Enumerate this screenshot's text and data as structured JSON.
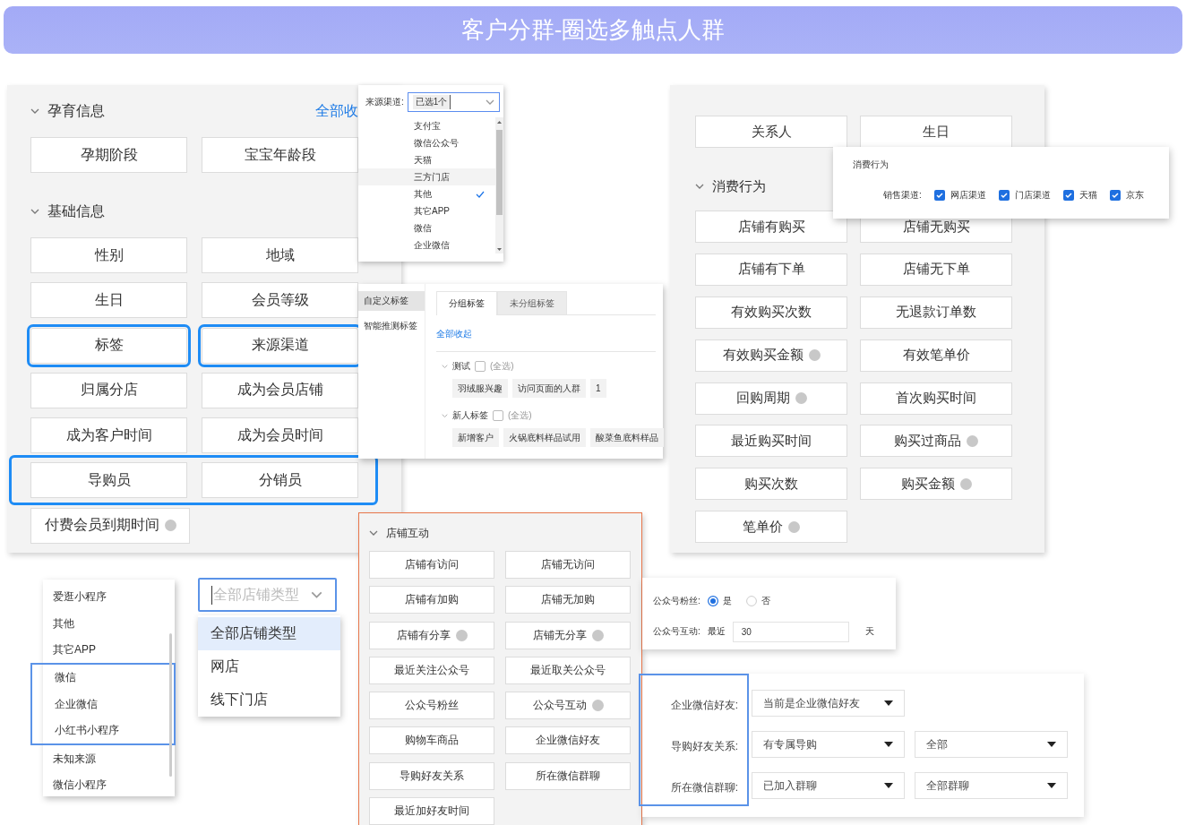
{
  "header": {
    "title": "客户分群-圈选多触点人群"
  },
  "panels": [
    {
      "kind": "buttons",
      "sections": [
        {
          "title": "孕育信息",
          "link": "全部收",
          "rows": [
            {
              "highlighted": false,
              "items": [
                {
                  "label": "孕期阶段",
                  "info": false,
                  "highlighted": false
                },
                {
                  "label": "宝宝年龄段",
                  "info": false,
                  "highlighted": false
                }
              ]
            }
          ]
        },
        {
          "title": "基础信息",
          "rows": [
            {
              "highlighted": false,
              "items": [
                {
                  "label": "性别",
                  "info": false,
                  "highlighted": false
                },
                {
                  "label": "地域",
                  "info": false,
                  "highlighted": false
                }
              ]
            },
            {
              "highlighted": false,
              "items": [
                {
                  "label": "生日",
                  "info": false,
                  "highlighted": false
                },
                {
                  "label": "会员等级",
                  "info": false,
                  "highlighted": false
                }
              ]
            },
            {
              "highlighted": false,
              "items": [
                {
                  "label": "标签",
                  "info": false,
                  "highlighted": true
                },
                {
                  "label": "来源渠道",
                  "info": false,
                  "highlighted": true
                }
              ]
            },
            {
              "highlighted": false,
              "items": [
                {
                  "label": "归属分店",
                  "info": false,
                  "highlighted": false
                },
                {
                  "label": "成为会员店铺",
                  "info": false,
                  "highlighted": false
                }
              ]
            },
            {
              "highlighted": false,
              "items": [
                {
                  "label": "成为客户时间",
                  "info": false,
                  "highlighted": false
                },
                {
                  "label": "成为会员时间",
                  "info": false,
                  "highlighted": false
                }
              ]
            },
            {
              "highlighted": true,
              "items": [
                {
                  "label": "导购员",
                  "info": false,
                  "highlighted": false
                },
                {
                  "label": "分销员",
                  "info": false,
                  "highlighted": false
                }
              ]
            },
            {
              "highlighted": false,
              "items": [
                {
                  "label": "付费会员到期时间",
                  "info": true,
                  "highlighted": false
                }
              ]
            }
          ]
        }
      ]
    },
    {
      "kind": "multi_dropdown",
      "label": "来源渠道:",
      "value": "已选1个",
      "options": [
        {
          "label": "支付宝",
          "selected": false,
          "hovered": false
        },
        {
          "label": "微信公众号",
          "selected": false,
          "hovered": false
        },
        {
          "label": "天猫",
          "selected": false,
          "hovered": false
        },
        {
          "label": "三方门店",
          "selected": false,
          "hovered": true
        },
        {
          "label": "其他",
          "selected": true,
          "hovered": false
        },
        {
          "label": "其它APP",
          "selected": false,
          "hovered": false
        },
        {
          "label": "微信",
          "selected": false,
          "hovered": false
        },
        {
          "label": "企业微信",
          "selected": false,
          "hovered": false
        }
      ]
    },
    {
      "kind": "tag_picker",
      "sidebar": [
        {
          "label": "自定义标签",
          "selected": true
        },
        {
          "label": "智能推测标签",
          "selected": false
        }
      ],
      "tabs": [
        {
          "label": "分组标签",
          "selected": true
        },
        {
          "label": "未分组标签",
          "selected": false
        }
      ],
      "link": "全部收起",
      "groups": [
        {
          "name": "测试",
          "checked": false,
          "select_all": "(全选)",
          "tags": [
            "羽绒服兴趣",
            "访问页面的人群",
            "1"
          ]
        },
        {
          "name": "新人标签",
          "checked": false,
          "select_all": "(全选)",
          "tags": [
            "新增客户",
            "火锅底料样品试用",
            "酸菜鱼底料样品"
          ]
        }
      ]
    },
    {
      "kind": "buttons",
      "sections": [
        {
          "rows": [
            {
              "highlighted": false,
              "items": [
                {
                  "label": "关系人",
                  "info": false,
                  "highlighted": false
                },
                {
                  "label": "生日",
                  "info": false,
                  "highlighted": false
                }
              ]
            }
          ]
        },
        {
          "title": "消费行为",
          "rows": [
            {
              "highlighted": false,
              "items": [
                {
                  "label": "店铺有购买",
                  "info": false,
                  "highlighted": false
                },
                {
                  "label": "店铺无购买",
                  "info": false,
                  "highlighted": false
                }
              ]
            },
            {
              "highlighted": false,
              "items": [
                {
                  "label": "店铺有下单",
                  "info": false,
                  "highlighted": false
                },
                {
                  "label": "店铺无下单",
                  "info": false,
                  "highlighted": false
                }
              ]
            },
            {
              "highlighted": false,
              "items": [
                {
                  "label": "有效购买次数",
                  "info": false,
                  "highlighted": false
                },
                {
                  "label": "无退款订单数",
                  "info": false,
                  "highlighted": false
                }
              ]
            },
            {
              "highlighted": false,
              "items": [
                {
                  "label": "有效购买金额",
                  "info": true,
                  "highlighted": false
                },
                {
                  "label": "有效笔单价",
                  "info": false,
                  "highlighted": false
                }
              ]
            },
            {
              "highlighted": false,
              "items": [
                {
                  "label": "回购周期",
                  "info": true,
                  "highlighted": false
                },
                {
                  "label": "首次购买时间",
                  "info": false,
                  "highlighted": false
                }
              ]
            },
            {
              "highlighted": false,
              "items": [
                {
                  "label": "最近购买时间",
                  "info": false,
                  "highlighted": false
                },
                {
                  "label": "购买过商品",
                  "info": true,
                  "highlighted": false
                }
              ]
            },
            {
              "highlighted": false,
              "items": [
                {
                  "label": "购买次数",
                  "info": false,
                  "highlighted": false
                },
                {
                  "label": "购买金额",
                  "info": true,
                  "highlighted": false
                }
              ]
            },
            {
              "highlighted": false,
              "items": [
                {
                  "label": "笔单价",
                  "info": true,
                  "highlighted": false
                }
              ]
            }
          ]
        }
      ]
    },
    {
      "kind": "checkbox_popup",
      "title": "消费行为",
      "label": "销售渠道:",
      "options": [
        {
          "label": "网店渠道",
          "checked": true
        },
        {
          "label": "门店渠道",
          "checked": true
        },
        {
          "label": "天猫",
          "checked": true
        },
        {
          "label": "京东",
          "checked": true
        }
      ]
    },
    {
      "kind": "list",
      "items": [
        {
          "label": "爱逛小程序",
          "highlighted": false
        },
        {
          "label": "其他",
          "highlighted": false
        },
        {
          "label": "其它APP",
          "highlighted": false
        },
        {
          "label": "微信",
          "highlighted": true
        },
        {
          "label": "企业微信",
          "highlighted": true
        },
        {
          "label": "小红书小程序",
          "highlighted": true
        },
        {
          "label": "未知来源",
          "highlighted": false
        },
        {
          "label": "微信小程序",
          "highlighted": false
        }
      ]
    },
    {
      "kind": "single_select",
      "placeholder": "全部店铺类型",
      "options": [
        {
          "label": "全部店铺类型",
          "selected": true
        },
        {
          "label": "网店",
          "selected": false
        },
        {
          "label": "线下门店",
          "selected": false
        }
      ]
    },
    {
      "kind": "buttons",
      "sections": [
        {
          "title": "店铺互动",
          "rows": [
            {
              "highlighted": false,
              "items": [
                {
                  "label": "店铺有访问",
                  "info": false,
                  "highlighted": false
                },
                {
                  "label": "店铺无访问",
                  "info": false,
                  "highlighted": false
                }
              ]
            },
            {
              "highlighted": false,
              "items": [
                {
                  "label": "店铺有加购",
                  "info": false,
                  "highlighted": false
                },
                {
                  "label": "店铺无加购",
                  "info": false,
                  "highlighted": false
                }
              ]
            },
            {
              "highlighted": false,
              "items": [
                {
                  "label": "店铺有分享",
                  "info": true,
                  "highlighted": false
                },
                {
                  "label": "店铺无分享",
                  "info": true,
                  "highlighted": false
                }
              ]
            },
            {
              "highlighted": false,
              "items": [
                {
                  "label": "最近关注公众号",
                  "info": false,
                  "highlighted": false
                },
                {
                  "label": "最近取关公众号",
                  "info": false,
                  "highlighted": false
                }
              ]
            },
            {
              "highlighted": false,
              "items": [
                {
                  "label": "公众号粉丝",
                  "info": false,
                  "highlighted": false
                },
                {
                  "label": "公众号互动",
                  "info": true,
                  "highlighted": false
                }
              ]
            },
            {
              "highlighted": false,
              "items": [
                {
                  "label": "购物车商品",
                  "info": false,
                  "highlighted": false
                },
                {
                  "label": "企业微信好友",
                  "info": false,
                  "highlighted": false
                }
              ]
            },
            {
              "highlighted": false,
              "items": [
                {
                  "label": "导购好友关系",
                  "info": false,
                  "highlighted": false
                },
                {
                  "label": "所在微信群聊",
                  "info": false,
                  "highlighted": false
                }
              ]
            },
            {
              "highlighted": false,
              "items": [
                {
                  "label": "最近加好友时间",
                  "info": false,
                  "highlighted": false
                }
              ]
            }
          ]
        }
      ]
    },
    {
      "kind": "radio_form",
      "rows": [
        {
          "kind": "radio",
          "label": "公众号粉丝:",
          "options": [
            {
              "label": "是",
              "selected": true
            },
            {
              "label": "否",
              "selected": false
            }
          ]
        },
        {
          "kind": "days",
          "label": "公众号互动:",
          "prefix": "最近",
          "value": "30",
          "suffix": "天"
        }
      ]
    },
    {
      "kind": "select_form",
      "labels_highlighted": true,
      "rows": [
        {
          "label": "企业微信好友:",
          "selects": [
            "当前是企业微信好友"
          ]
        },
        {
          "label": "导购好友关系:",
          "selects": [
            "有专属导购",
            "全部"
          ]
        },
        {
          "label": "所在微信群聊:",
          "selects": [
            "已加入群聊",
            "全部群聊"
          ]
        }
      ]
    }
  ]
}
